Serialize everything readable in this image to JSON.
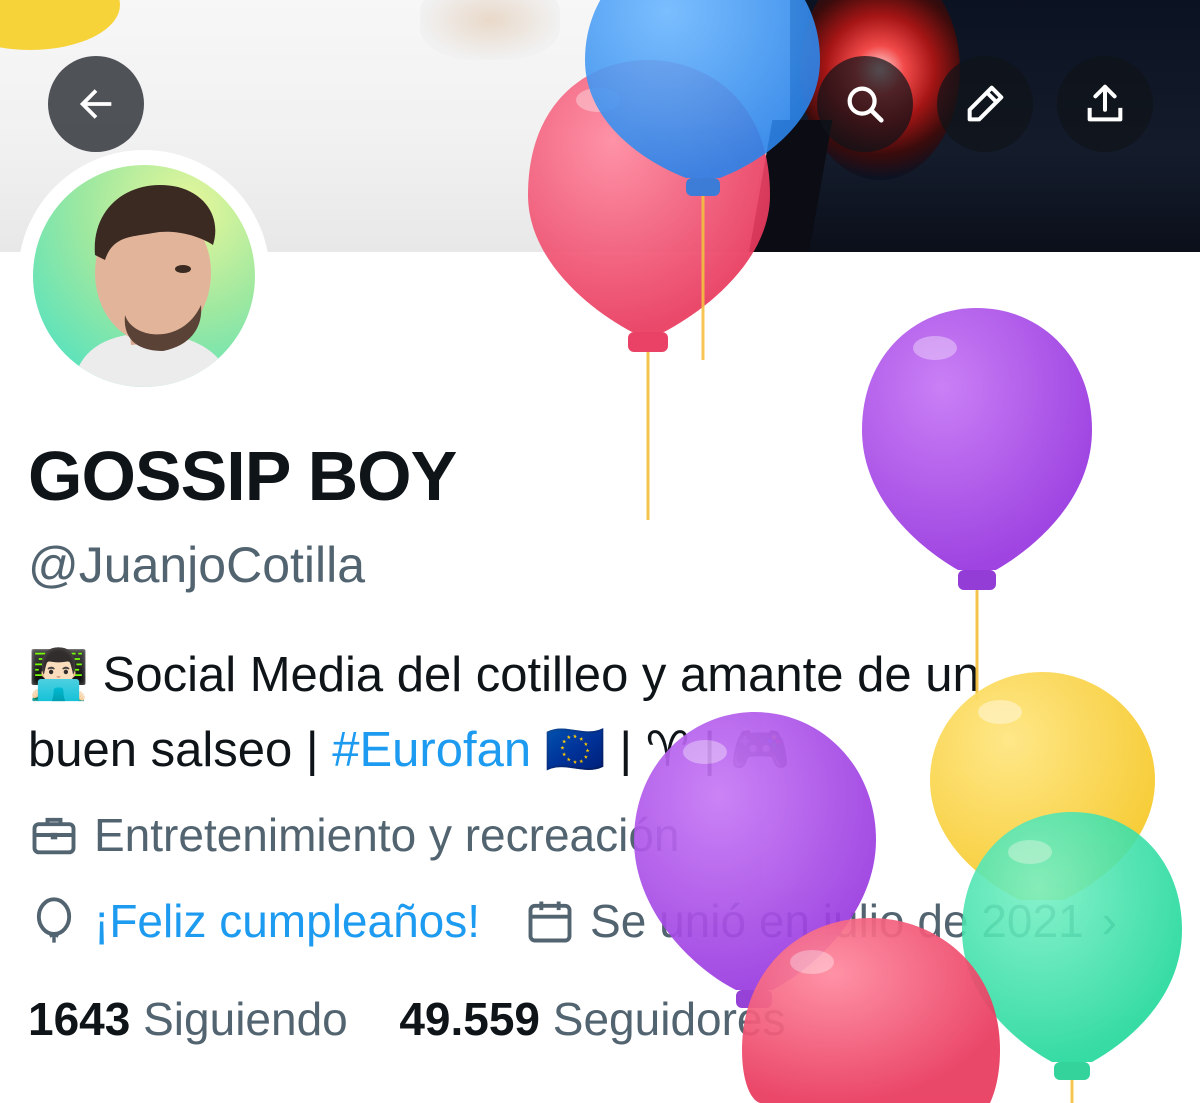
{
  "header": {
    "back_icon": "arrow-left-icon",
    "search_icon": "search-icon",
    "edit_icon": "pencil-icon",
    "share_icon": "upload-icon"
  },
  "profile": {
    "display_name": "GOSSIP BOY",
    "handle": "@JuanjoCotilla",
    "bio_emoji": "👨🏻‍💻",
    "bio_text_1": "Social Media del cotilleo y amante de un",
    "bio_text_2": "buen salseo | ",
    "bio_hashtag": "#Eurofan",
    "bio_tail": " 🇪🇺 | ♈ | 🎮",
    "category": "Entretenimiento y recreación",
    "birthday_text": "¡Feliz cumpleaños!",
    "joined_text": "Se unió en julio de 2021",
    "following_count": "1643",
    "following_label": "Siguiendo",
    "followers_count": "49.559",
    "followers_label": "Seguidores"
  },
  "colors": {
    "link": "#1d9bf0",
    "secondary_text": "#536471",
    "balloon_red": "#f0476a",
    "balloon_purple": "#a845e8",
    "balloon_yellow": "#f8d13a",
    "balloon_green": "#33e0a6",
    "balloon_blue": "#2b8ff0"
  }
}
